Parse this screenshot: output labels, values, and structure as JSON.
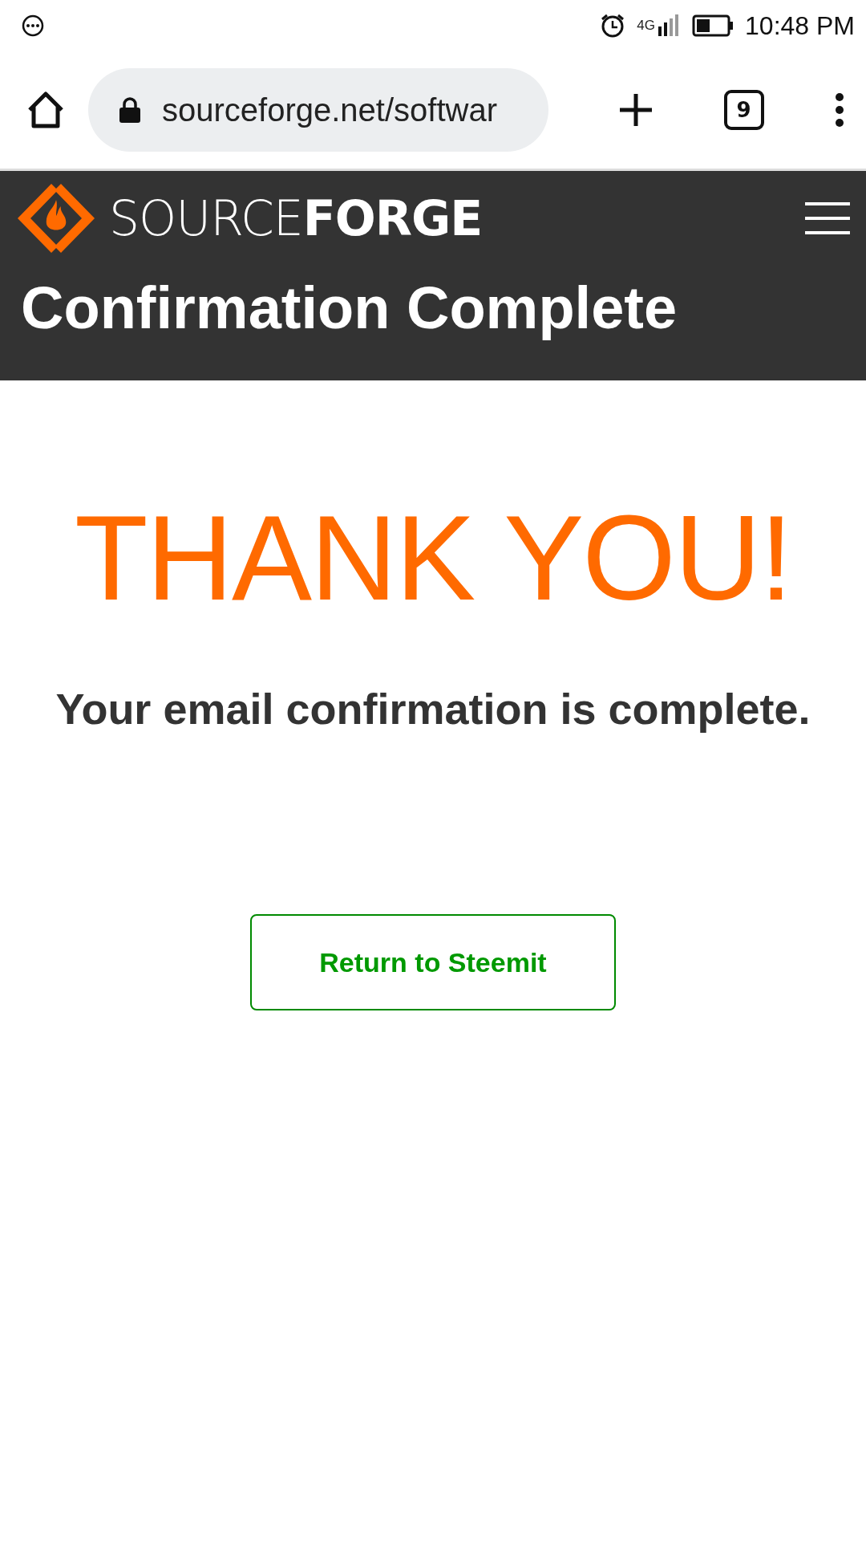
{
  "status_bar": {
    "network": "4G",
    "time": "10:48 PM"
  },
  "browser": {
    "url": "sourceforge.net/softwar",
    "tab_count": "9"
  },
  "header": {
    "logo": "SOURCE**FORGE**",
    "title": "Confirmation Complete"
  },
  "content": {
    "heading": "THANK YOU!",
    "message": "Your email confirmation is complete.",
    "button": "Return to Steemit"
  }
}
